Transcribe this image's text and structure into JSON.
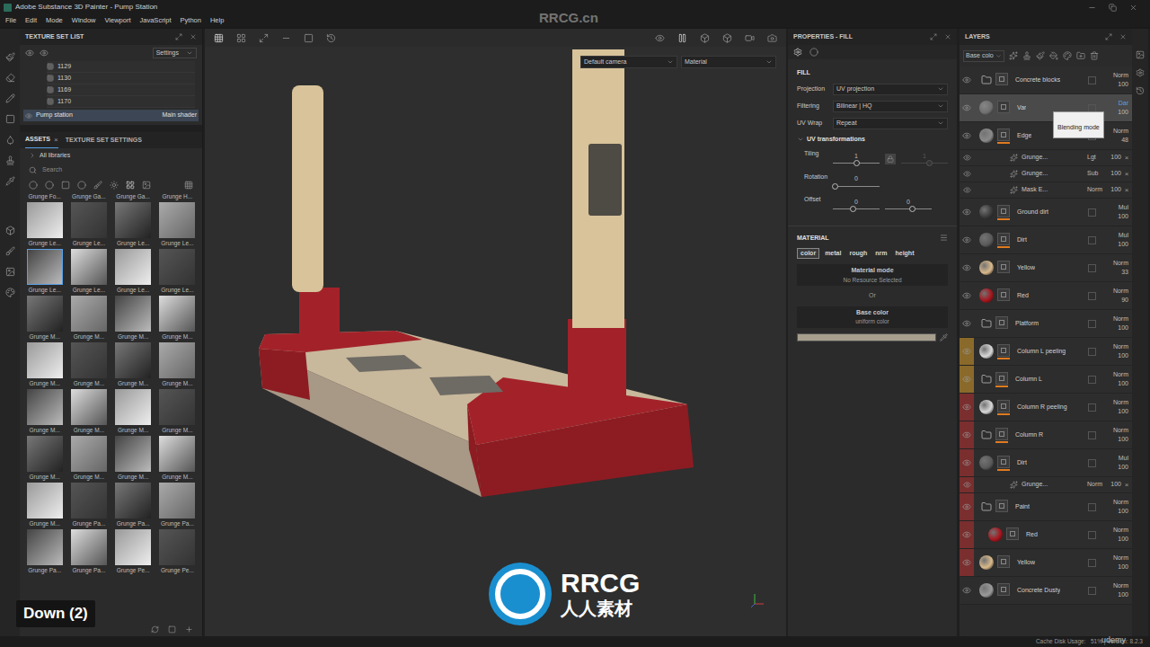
{
  "window": {
    "title": "Adobe Substance 3D Painter - Pump Station"
  },
  "menu": [
    "File",
    "Edit",
    "Mode",
    "Window",
    "Viewport",
    "JavaScript",
    "Python",
    "Help"
  ],
  "texture_set_list": {
    "title": "TEXTURE SET LIST",
    "settings": "Settings",
    "rows": [
      "1129",
      "1130",
      "1169",
      "1170"
    ],
    "active": {
      "name": "Pump station",
      "shader": "Main shader"
    }
  },
  "assets": {
    "tabs": [
      {
        "label": "ASSETS",
        "selected": true,
        "close": "×"
      },
      {
        "label": "TEXTURE SET SETTINGS",
        "selected": false
      }
    ],
    "library": "All libraries",
    "search": "Search",
    "items": [
      {
        "label": "Grunge Fo...",
        "selected": false
      },
      {
        "label": "Grunge Ga...",
        "selected": false
      },
      {
        "label": "Grunge Ga...",
        "selected": false
      },
      {
        "label": "Grunge H...",
        "selected": false
      },
      {
        "label": "Grunge Le...",
        "selected": false
      },
      {
        "label": "Grunge Le...",
        "selected": false
      },
      {
        "label": "Grunge Le...",
        "selected": false
      },
      {
        "label": "Grunge Le...",
        "selected": false
      },
      {
        "label": "Grunge Le...",
        "selected": true
      },
      {
        "label": "Grunge Le...",
        "selected": false
      },
      {
        "label": "Grunge Le...",
        "selected": false
      },
      {
        "label": "Grunge Le...",
        "selected": false
      },
      {
        "label": "Grunge M...",
        "selected": false
      },
      {
        "label": "Grunge M...",
        "selected": false
      },
      {
        "label": "Grunge M...",
        "selected": false
      },
      {
        "label": "Grunge M...",
        "selected": false
      },
      {
        "label": "Grunge M...",
        "selected": false
      },
      {
        "label": "Grunge M...",
        "selected": false
      },
      {
        "label": "Grunge M...",
        "selected": false
      },
      {
        "label": "Grunge M...",
        "selected": false
      },
      {
        "label": "Grunge M...",
        "selected": false
      },
      {
        "label": "Grunge M...",
        "selected": false
      },
      {
        "label": "Grunge M...",
        "selected": false
      },
      {
        "label": "Grunge M...",
        "selected": false
      },
      {
        "label": "Grunge M...",
        "selected": false
      },
      {
        "label": "Grunge M...",
        "selected": false
      },
      {
        "label": "Grunge M...",
        "selected": false
      },
      {
        "label": "Grunge M...",
        "selected": false
      },
      {
        "label": "Grunge M...",
        "selected": false
      },
      {
        "label": "Grunge Pa...",
        "selected": false
      },
      {
        "label": "Grunge Pa...",
        "selected": false
      },
      {
        "label": "Grunge Pa...",
        "selected": false
      },
      {
        "label": "Grunge Pa...",
        "selected": false
      },
      {
        "label": "Grunge Pa...",
        "selected": false
      },
      {
        "label": "Grunge Pe...",
        "selected": false
      },
      {
        "label": "Grunge Pe...",
        "selected": false
      }
    ]
  },
  "viewport": {
    "camera": "Default camera",
    "mode": "Material",
    "key_overlay": "Down (2)"
  },
  "properties": {
    "title": "PROPERTIES - FILL",
    "section": "FILL",
    "fields": [
      {
        "label": "Projection",
        "value": "UV projection"
      },
      {
        "label": "Filtering",
        "value": "Bilinear | HQ"
      },
      {
        "label": "UV Wrap",
        "value": "Repeat"
      }
    ],
    "uv_title": "UV transformations",
    "sliders": [
      {
        "label": "Tiling",
        "a": {
          "value": "1",
          "level": 0.5,
          "disabled": false
        },
        "b": {
          "value": "1",
          "level": 0.6,
          "disabled": true
        },
        "locked": true
      },
      {
        "label": "Rotation",
        "a": {
          "value": "0",
          "level": 0.04,
          "disabled": false
        }
      },
      {
        "label": "Offset",
        "a": {
          "value": "0",
          "level": 0.42,
          "disabled": false
        },
        "b": {
          "value": "0",
          "level": 0.58,
          "disabled": false
        }
      }
    ],
    "material_title": "MATERIAL",
    "channels": [
      {
        "label": "color",
        "selected": true
      },
      {
        "label": "metal",
        "selected": false
      },
      {
        "label": "rough",
        "selected": false
      },
      {
        "label": "nrm",
        "selected": false
      },
      {
        "label": "height",
        "selected": false
      }
    ],
    "material_mode": "Material mode",
    "no_resource": "No Resource Selected",
    "or": "Or",
    "base_color": "Base color",
    "uniform": "uniform color",
    "swatch": "#a79e8e"
  },
  "layers": {
    "title": "LAYERS",
    "channel": "Base colo",
    "tooltip": "Blending mode",
    "items": [
      {
        "name": "Concrete blocks",
        "kind": "folder",
        "blend": "Norm",
        "opacity": "100",
        "depth": 0,
        "visible": true,
        "selected": false,
        "masked": false
      },
      {
        "name": "Var",
        "kind": "layer",
        "blend": "Dar",
        "opacity": "100",
        "depth": 0,
        "visible": true,
        "selected": true,
        "masked": false,
        "swatch": "#6f6f6f"
      },
      {
        "name": "Edge",
        "kind": "layer",
        "blend": "Norm",
        "opacity": "48",
        "depth": 0,
        "visible": true,
        "selected": false,
        "masked": true,
        "swatch": "#8a8a8a"
      },
      {
        "name": "Grunge...",
        "kind": "effect",
        "blend": "Lgt",
        "opacity": "100",
        "depth": 1,
        "visible": true,
        "selected": false,
        "close": "×"
      },
      {
        "name": "Grunge...",
        "kind": "effect",
        "blend": "Sub",
        "opacity": "100",
        "depth": 1,
        "visible": true,
        "selected": false,
        "close": "×"
      },
      {
        "name": "Mask E...",
        "kind": "effect",
        "blend": "Norm",
        "opacity": "100",
        "depth": 1,
        "visible": true,
        "selected": false,
        "close": "×"
      },
      {
        "name": "Ground dirt",
        "kind": "layer",
        "blend": "Mul",
        "opacity": "100",
        "depth": 0,
        "visible": true,
        "selected": false,
        "masked": true,
        "swatch": "#3a3a3a"
      },
      {
        "name": "Dirt",
        "kind": "layer",
        "blend": "Mul",
        "opacity": "100",
        "depth": 0,
        "visible": true,
        "selected": false,
        "masked": true,
        "swatch": "#5a5a5a"
      },
      {
        "name": "Yellow",
        "kind": "layer",
        "blend": "Norm",
        "opacity": "33",
        "depth": 0,
        "visible": true,
        "selected": false,
        "masked": false,
        "swatch": "#d9b98a"
      },
      {
        "name": "Red",
        "kind": "layer",
        "blend": "Norm",
        "opacity": "90",
        "depth": 0,
        "visible": true,
        "selected": false,
        "masked": false,
        "swatch": "#a8141c"
      },
      {
        "name": "Platform",
        "kind": "folder",
        "blend": "Norm",
        "opacity": "100",
        "depth": 0,
        "visible": true,
        "selected": false,
        "masked": false
      },
      {
        "name": "Column L peeling",
        "kind": "layer",
        "blend": "Norm",
        "opacity": "100",
        "depth": 0,
        "visible": true,
        "selected": false,
        "masked": true,
        "swatch": "#d8d8d8",
        "color": "#8a6a2a"
      },
      {
        "name": "Column L",
        "kind": "folder",
        "blend": "Norm",
        "opacity": "100",
        "depth": 0,
        "visible": true,
        "selected": false,
        "masked": true,
        "color": "#8a6a2a"
      },
      {
        "name": "Column R peeling",
        "kind": "layer",
        "blend": "Norm",
        "opacity": "100",
        "depth": 0,
        "visible": true,
        "selected": false,
        "masked": true,
        "swatch": "#d8d8d8",
        "color": "#7a2e2e"
      },
      {
        "name": "Column R",
        "kind": "folder",
        "blend": "Norm",
        "opacity": "100",
        "depth": 0,
        "visible": true,
        "selected": false,
        "masked": true,
        "color": "#7a2e2e"
      },
      {
        "name": "Dirt",
        "kind": "layer",
        "blend": "Mul",
        "opacity": "100",
        "depth": 0,
        "visible": true,
        "selected": false,
        "masked": true,
        "swatch": "#5a5a5a",
        "color": "#7a2e2e"
      },
      {
        "name": "Grunge...",
        "kind": "effect",
        "blend": "Norm",
        "opacity": "100",
        "depth": 1,
        "visible": true,
        "selected": false,
        "close": "×",
        "color": "#7a2e2e"
      },
      {
        "name": "Paint",
        "kind": "folder",
        "blend": "Norm",
        "opacity": "100",
        "depth": 1,
        "visible": true,
        "selected": false,
        "masked": false,
        "color": "#7a2e2e"
      },
      {
        "name": "Red",
        "kind": "layer",
        "blend": "Norm",
        "opacity": "100",
        "depth": 2,
        "visible": true,
        "selected": false,
        "masked": false,
        "swatch": "#a8141c",
        "color": "#7a2e2e"
      },
      {
        "name": "Yellow",
        "kind": "layer",
        "blend": "Norm",
        "opacity": "100",
        "depth": 1,
        "visible": true,
        "selected": false,
        "masked": false,
        "swatch": "#d9b98a",
        "color": "#7a2e2e"
      },
      {
        "name": "Concrete Dusty",
        "kind": "layer",
        "blend": "Norm",
        "opacity": "100",
        "depth": 0,
        "visible": true,
        "selected": false,
        "masked": false,
        "swatch": "#9a9a9a"
      }
    ]
  },
  "watermarks": {
    "top": "RRCG.cn",
    "logo": "RRCG",
    "logo_sub": "人人素材",
    "udemy": "udemy"
  },
  "status": "Cache Disk Usage:   51% | Version: 8.2.3"
}
